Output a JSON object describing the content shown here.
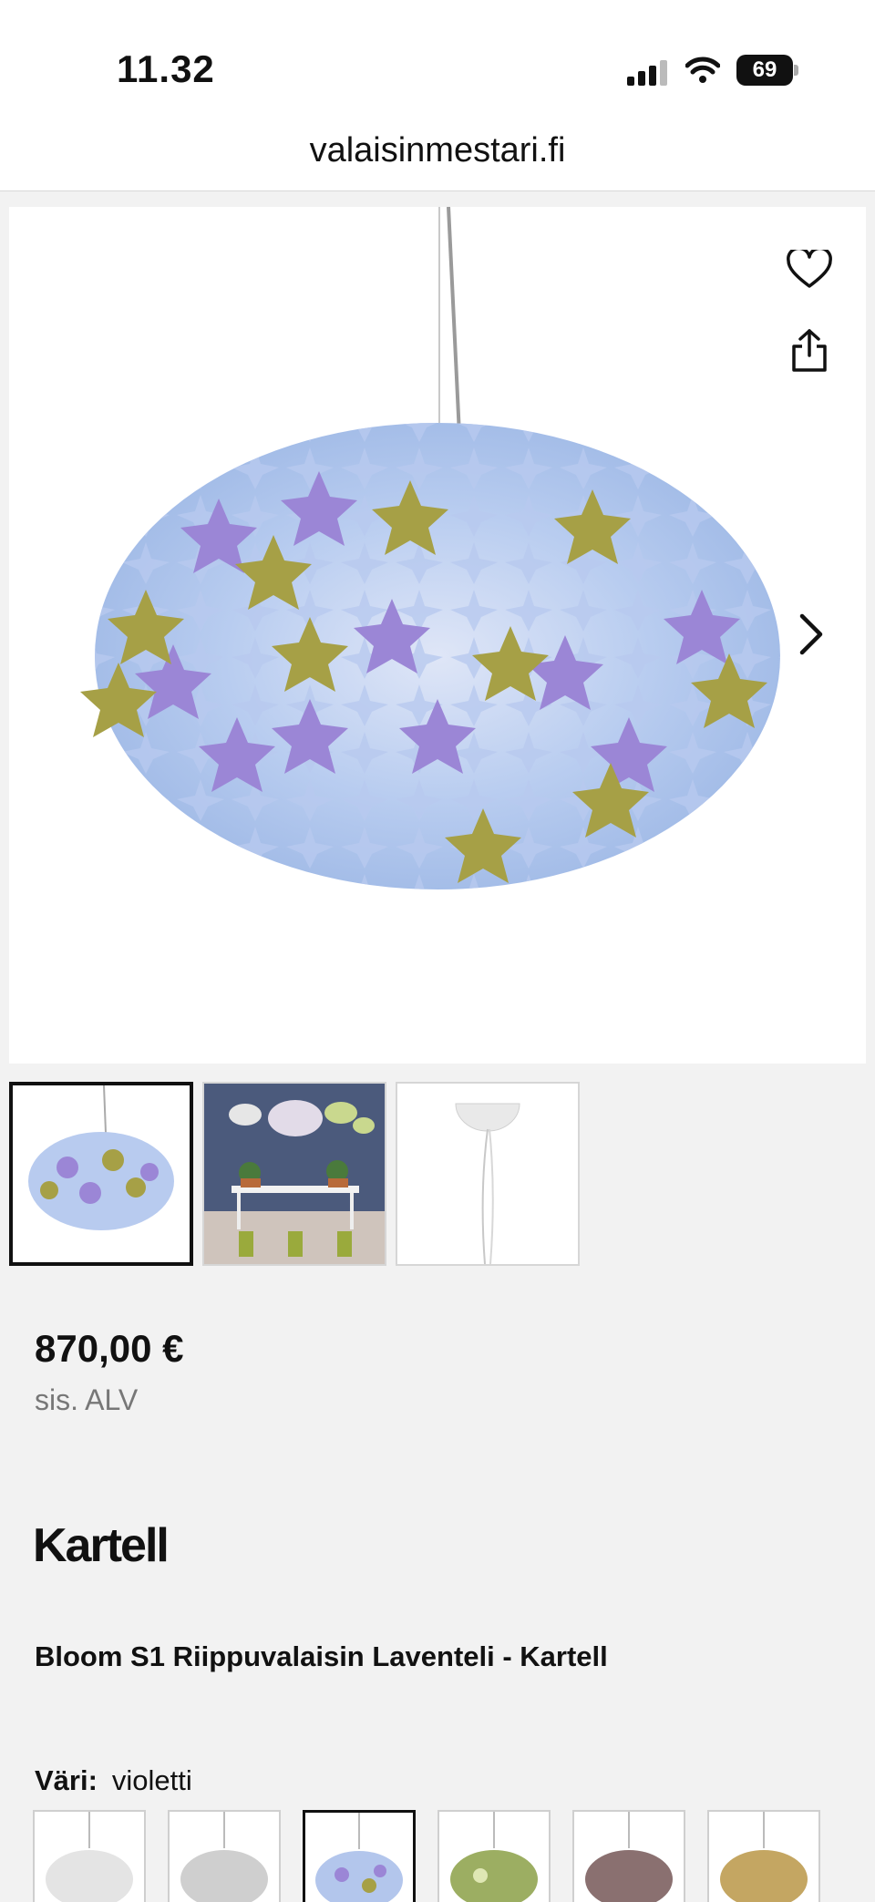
{
  "status_bar": {
    "time": "11.32",
    "battery": "69"
  },
  "browser": {
    "url": "valaisinmestari.fi"
  },
  "product": {
    "price": "870,00 €",
    "vat_note": "sis. ALV",
    "brand_logo": "Kartell",
    "title": "Bloom S1 Riippuvalaisin Laventeli - Kartell",
    "color_label": "Väri:",
    "color_value": "violetti"
  },
  "gallery": {
    "icons": [
      "heart-icon",
      "share-icon",
      "chevron-right-icon"
    ],
    "thumbnails": [
      "lamp-lavender",
      "lamps-room-scene",
      "ceiling-canopy"
    ],
    "active_index": 0
  },
  "swatches": {
    "colors": [
      "#e4e4e4",
      "#cfcfcf",
      "#b3a8d8",
      "#9cae62",
      "#8a7070",
      "#c4a662"
    ],
    "active_index": 2
  },
  "colors": {
    "background": "#f2f2f2",
    "text": "#111111",
    "muted": "#777777",
    "lavender": "#9b86d6",
    "light_blue": "#a9c7ee",
    "olive": "#a6a046"
  }
}
